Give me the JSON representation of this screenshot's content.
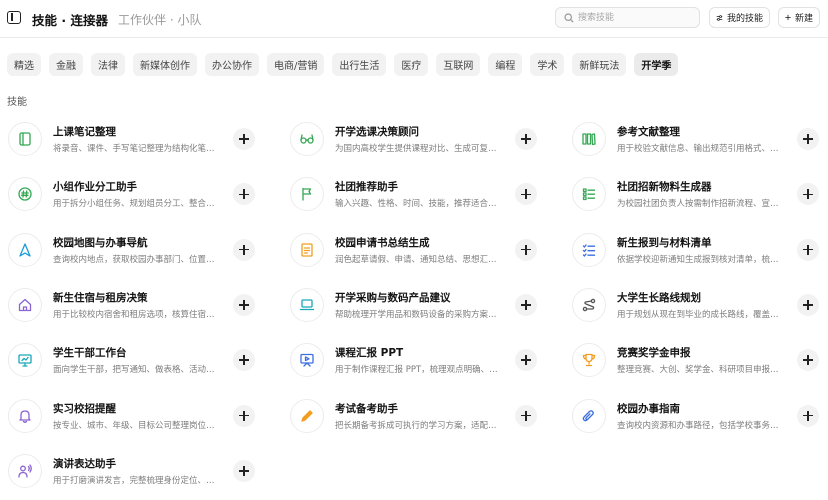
{
  "header": {
    "title": "技能 · 连接器",
    "subtitle": "工作伙伴 · 小队",
    "search_placeholder": "搜索技能",
    "my_skills_label": "我的技能",
    "new_label": "新建"
  },
  "categories": [
    {
      "label": "精选"
    },
    {
      "label": "金融"
    },
    {
      "label": "法律"
    },
    {
      "label": "新媒体创作"
    },
    {
      "label": "办公协作"
    },
    {
      "label": "电商/营销"
    },
    {
      "label": "出行生活"
    },
    {
      "label": "医疗"
    },
    {
      "label": "互联网"
    },
    {
      "label": "编程"
    },
    {
      "label": "学术"
    },
    {
      "label": "新鲜玩法"
    },
    {
      "label": "开学季",
      "active": true
    }
  ],
  "section_label": "技能",
  "skills": [
    {
      "name": "上课笔记整理",
      "desc": "将录音、课件、手写笔记整理为结构化笔…",
      "icon": "notebook-icon",
      "color": "#34a853"
    },
    {
      "name": "开学选课决策顾问",
      "desc": "为国内高校学生提供课程对比、生成可复…",
      "icon": "glasses-icon",
      "color": "#34a853"
    },
    {
      "name": "参考文献整理",
      "desc": "用于校验文献信息、输出规范引用格式、…",
      "icon": "library-icon",
      "color": "#34a853"
    },
    {
      "name": "小组作业分工助手",
      "desc": "用于拆分小组任务、规划组员分工、整合…",
      "icon": "hashtag-icon",
      "color": "#34a853"
    },
    {
      "name": "社团推荐助手",
      "desc": "输入兴趣、性格、时间、技能，推荐适合…",
      "icon": "flag-icon",
      "color": "#34a853"
    },
    {
      "name": "社团招新物料生成器",
      "desc": "为校园社团负责人按需制作招新流程、宣…",
      "icon": "list-icon",
      "color": "#34a853"
    },
    {
      "name": "校园地图与办事导航",
      "desc": "查询校内地点，获取校园办事部门、位置…",
      "icon": "navigation-icon",
      "color": "#1a9bd7"
    },
    {
      "name": "校园申请书总结生成",
      "desc": "润色起草请假、申请、通知总结、思想汇…",
      "icon": "document-icon",
      "color": "#f29d1f"
    },
    {
      "name": "新生报到与材料清单",
      "desc": "依据学校迎新通知生成报到核对清单，梳…",
      "icon": "checklist-icon",
      "color": "#3b6fe0"
    },
    {
      "name": "新生住宿与租房决策",
      "desc": "用于比较校内宿舍和租房选项，核算住宿…",
      "icon": "home-icon",
      "color": "#8a63d2"
    },
    {
      "name": "开学采购与数码产品建议",
      "desc": "帮助梳理开学用品和数码设备的采购方案…",
      "icon": "laptop-icon",
      "color": "#1aa6b7"
    },
    {
      "name": "大学生长路线规划",
      "desc": "用于规划从现在到毕业的成长路线，覆盖…",
      "icon": "route-icon",
      "color": "#555555"
    },
    {
      "name": "学生干部工作台",
      "desc": "面向学生干部，把写通知、做表格、活动…",
      "icon": "monitor-icon",
      "color": "#1aa6b7"
    },
    {
      "name": "课程汇报 PPT",
      "desc": "用于制作课程汇报 PPT，梳理观点明确、…",
      "icon": "presentation-icon",
      "color": "#3b6fe0"
    },
    {
      "name": "竞赛奖学金申报",
      "desc": "整理竞赛、大创、奖学金、科研项目申报…",
      "icon": "trophy-icon",
      "color": "#f29d1f"
    },
    {
      "name": "实习校招提醒",
      "desc": "按专业、城市、年级、目标公司整理岗位…",
      "icon": "bell-icon",
      "color": "#8a63d2"
    },
    {
      "name": "考试备考助手",
      "desc": "把长期备考拆成可执行的学习方案，适配…",
      "icon": "pencil-icon",
      "color": "#f29d1f"
    },
    {
      "name": "校园办事指南",
      "desc": "查询校内资源和办事路径，包括学校事务…",
      "icon": "paperclip-icon",
      "color": "#3b6fe0"
    },
    {
      "name": "演讲表达助手",
      "desc": "用于打磨演讲发言，完整梳理身份定位、…",
      "icon": "speaker-icon",
      "color": "#8a63d2"
    }
  ]
}
